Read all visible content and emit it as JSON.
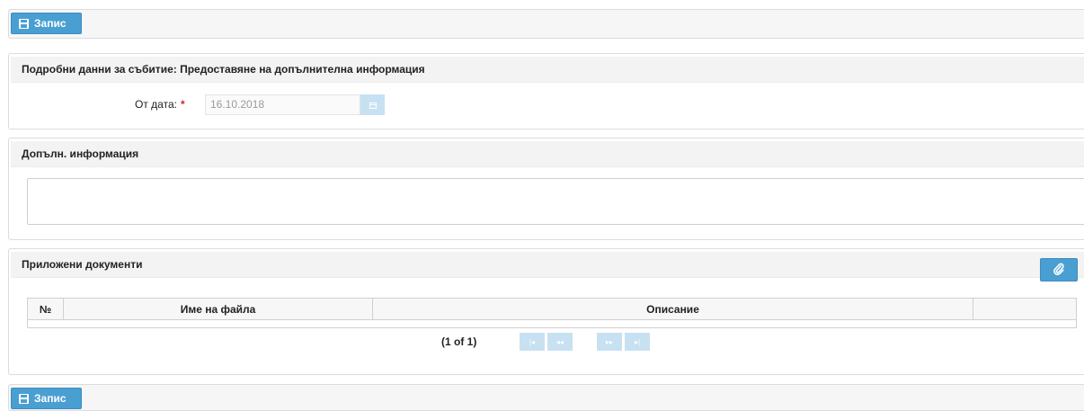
{
  "toolbar": {
    "save_label": "Запис"
  },
  "event_panel": {
    "title": "Подробни данни за събитие: Предоставяне на допълнителна информация",
    "from_date_label": "От дата:",
    "required_mark": "*",
    "from_date_value": "16.10.2018"
  },
  "info_panel": {
    "title": "Допълн. информация",
    "value": ""
  },
  "docs_panel": {
    "title": "Приложени документи",
    "columns": [
      "№",
      "Име на файла",
      "Описание",
      ""
    ],
    "pager": {
      "text": "(1 of 1)",
      "first": "|◂",
      "prev": "◂◂",
      "next": "▸▸",
      "last": "▸|"
    }
  },
  "colors": {
    "accent": "#4a9fd2",
    "disabled_button": "#c8e1f2",
    "required": "#d22222"
  }
}
